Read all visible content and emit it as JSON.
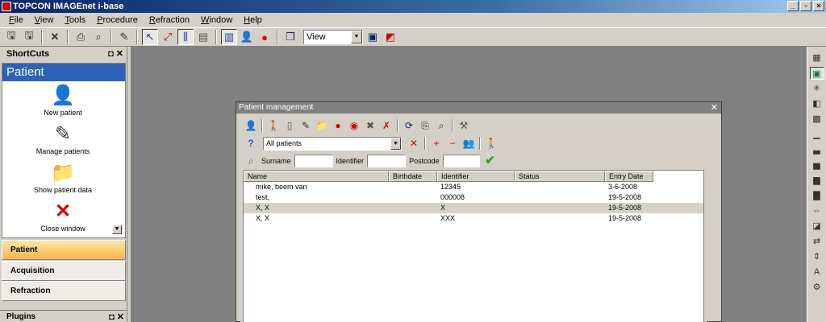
{
  "app": {
    "title": "TOPCON IMAGEnet i-base"
  },
  "menu": [
    "File",
    "View",
    "Tools",
    "Procedure",
    "Refraction",
    "Window",
    "Help"
  ],
  "toolbar": {
    "view_select": "View"
  },
  "shortcuts": {
    "header": "ShortCuts",
    "panel_title": "Patient",
    "items": [
      {
        "label": "New patient",
        "icon": "person-icon"
      },
      {
        "label": "Manage patients",
        "icon": "edit-icon"
      },
      {
        "label": "Show patient data",
        "icon": "folder-icon"
      },
      {
        "label": "Close window",
        "icon": "close-icon"
      }
    ]
  },
  "nav": [
    "Patient",
    "Acquisition",
    "Refraction"
  ],
  "plugins": {
    "header": "Plugins"
  },
  "dialog": {
    "title": "Patient management",
    "filter_value": "All patients",
    "search_labels": {
      "surname": "Surname",
      "identifier": "Identifier",
      "postcode": "Postcode"
    },
    "columns": [
      "Name",
      "Birthdate",
      "Identifier",
      "Status",
      "Entry Date"
    ],
    "rows": [
      {
        "name": "mike, beem van",
        "birthdate": "",
        "identifier": "12345",
        "status": "",
        "entry_date": "3-6-2008"
      },
      {
        "name": "test,",
        "birthdate": "",
        "identifier": "000008",
        "status": "",
        "entry_date": "19-5-2008"
      },
      {
        "name": "X, X",
        "birthdate": "",
        "identifier": "X",
        "status": "",
        "entry_date": "19-5-2008"
      },
      {
        "name": "X, X",
        "birthdate": "",
        "identifier": "XXX",
        "status": "",
        "entry_date": "19-5-2008"
      }
    ],
    "selected_row": 2
  },
  "colors": {
    "title_gradient_start": "#0a246a",
    "shortcut_header": "#2d63b6",
    "active_nav": "#f7b74a",
    "workspace": "#808080"
  }
}
